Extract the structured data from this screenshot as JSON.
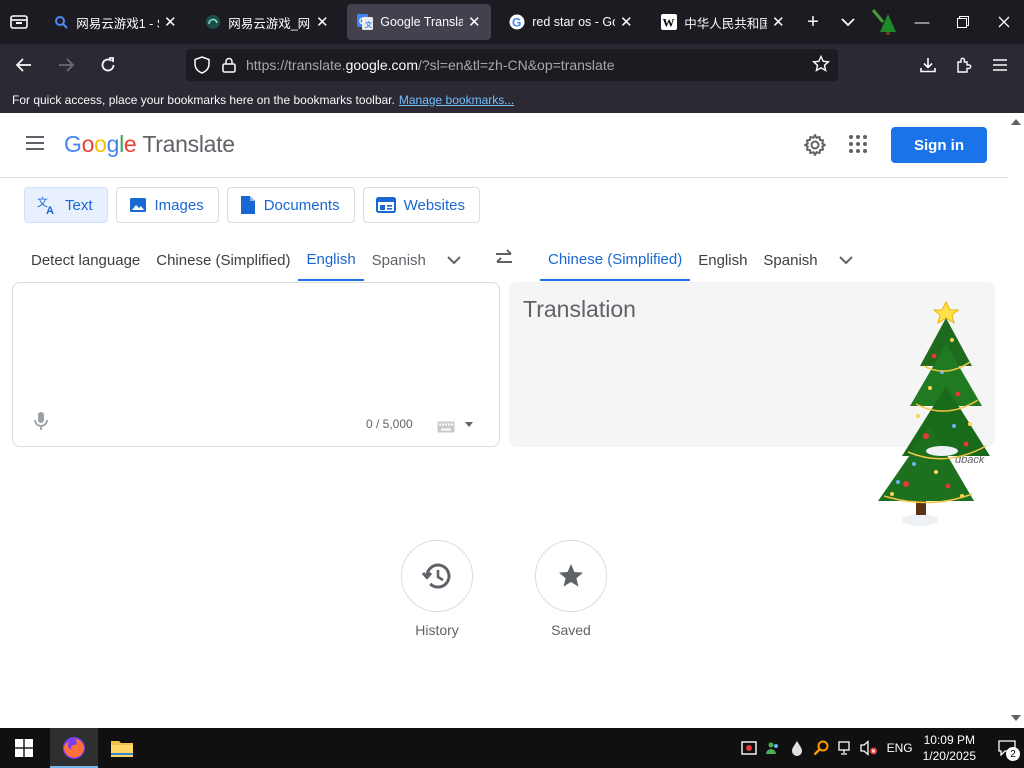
{
  "browser": {
    "tabs": [
      {
        "title": "网易云游戏1 - S",
        "favicon": "search-icon",
        "active": false
      },
      {
        "title": "网易云游戏_网易",
        "favicon": "cloud-game-icon",
        "active": false
      },
      {
        "title": "Google Translat",
        "favicon": "google-translate-icon",
        "active": true
      },
      {
        "title": "red star os - Goo",
        "favicon": "google-icon",
        "active": false
      },
      {
        "title": "中华人民共和国",
        "favicon": "wikipedia-icon",
        "active": false
      }
    ],
    "url": {
      "prefix": "https://translate.",
      "domain": "google.com",
      "suffix": "/?sl=en&tl=zh-CN&op=translate"
    },
    "bookmarks_bar": {
      "text": "For quick access, place your bookmarks here on the bookmarks toolbar.",
      "link": "Manage bookmarks..."
    }
  },
  "translate": {
    "logo_google": [
      "G",
      "o",
      "o",
      "g",
      "l",
      "e"
    ],
    "logo_product": "Translate",
    "sign_in": "Sign in",
    "modes": [
      {
        "label": "Text",
        "icon": "translate-icon",
        "active": true
      },
      {
        "label": "Images",
        "icon": "image-icon",
        "active": false
      },
      {
        "label": "Documents",
        "icon": "document-icon",
        "active": false
      },
      {
        "label": "Websites",
        "icon": "website-icon",
        "active": false
      }
    ],
    "source_langs": [
      "Detect language",
      "Chinese (Simplified)",
      "English",
      "Spanish"
    ],
    "source_active": "English",
    "target_langs": [
      "Chinese (Simplified)",
      "English",
      "Spanish"
    ],
    "target_active": "Chinese (Simplified)",
    "char_count": "0 / 5,000",
    "translation_placeholder": "Translation",
    "feedback": "dback",
    "history_label": "History",
    "saved_label": "Saved"
  },
  "taskbar": {
    "lang": "ENG",
    "time": "10:09 PM",
    "date": "1/20/2025",
    "notification_count": "2"
  },
  "colors": {
    "tab_bg": "#1c1b22",
    "toolbar_bg": "#2b2a33",
    "accent_blue": "#1a73e8",
    "link_blue": "#1967d2"
  }
}
